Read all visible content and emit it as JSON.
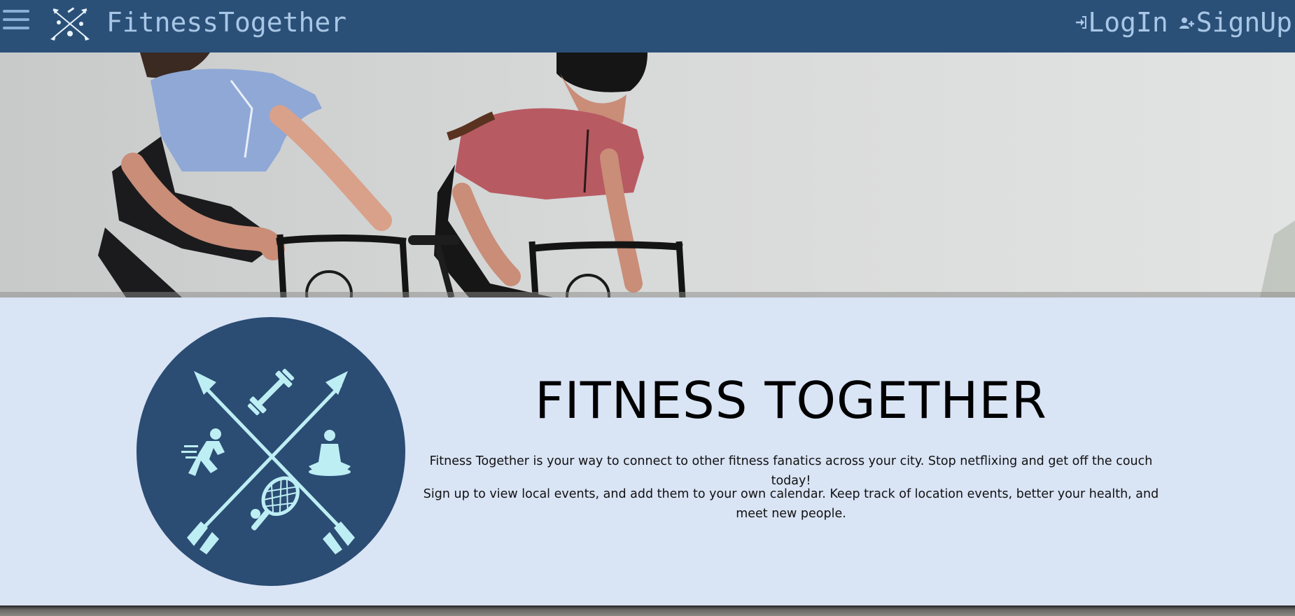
{
  "navbar": {
    "brand": "FitnessTogether",
    "login_label": "LogIn",
    "signup_label": "SignUp",
    "icons": [
      "hamburger-menu-icon",
      "logo-icon",
      "login-icon",
      "user-plus-icon"
    ]
  },
  "hero": {
    "image": "cyclists-hero-photo"
  },
  "main": {
    "title": "FITNESS TOGETHER",
    "paragraph1": "Fitness Together is your way to connect to other fitness fanatics across your city. Stop netflixing and get off the couch today!",
    "paragraph2": "Sign up to view local events, and add them to your own calendar. Keep track of location events, better your health, and meet new people."
  },
  "colors": {
    "navbar": "#2b5078",
    "nav_text": "#a9c7e6",
    "content_bg": "#d9e4f5",
    "badge_circle": "#2b4c73",
    "badge_icon": "#bdeef4"
  }
}
